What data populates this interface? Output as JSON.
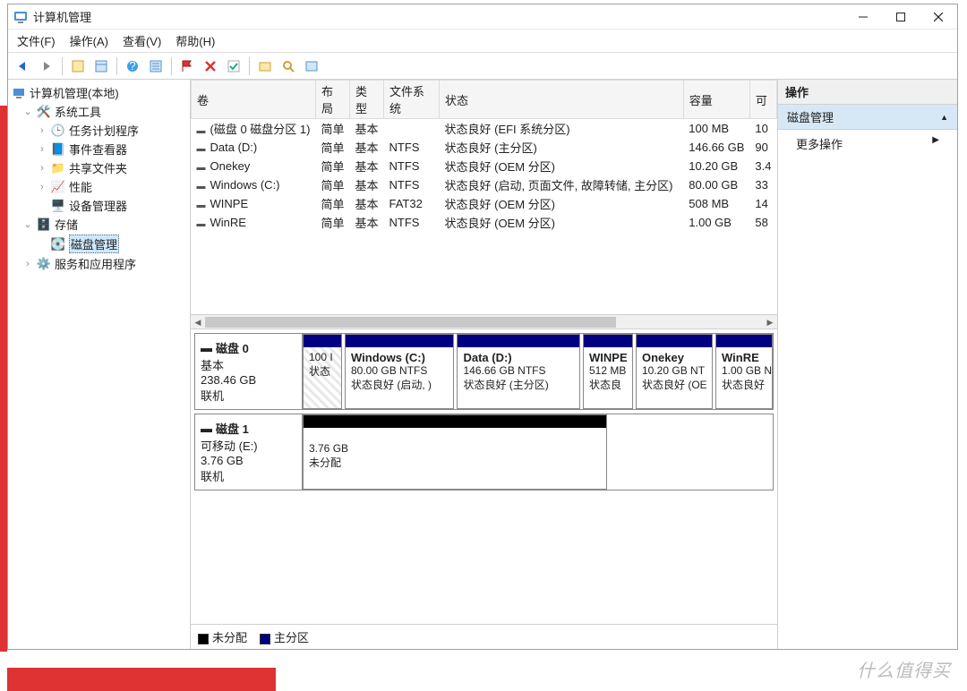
{
  "window": {
    "title": "计算机管理"
  },
  "menu": {
    "file": "文件(F)",
    "action": "操作(A)",
    "view": "查看(V)",
    "help": "帮助(H)"
  },
  "tree": {
    "root": "计算机管理(本地)",
    "systools": "系统工具",
    "task": "任务计划程序",
    "event": "事件查看器",
    "shared": "共享文件夹",
    "perf": "性能",
    "devmgr": "设备管理器",
    "storage": "存储",
    "diskmgmt": "磁盘管理",
    "services": "服务和应用程序"
  },
  "cols": {
    "vol": "卷",
    "layout": "布局",
    "type": "类型",
    "fs": "文件系统",
    "status": "状态",
    "cap": "容量",
    "free": "可"
  },
  "volumes": [
    {
      "name": "(磁盘 0 磁盘分区 1)",
      "layout": "简单",
      "type": "基本",
      "fs": "",
      "status": "状态良好 (EFI 系统分区)",
      "cap": "100 MB",
      "free": "10"
    },
    {
      "name": "Data (D:)",
      "layout": "简单",
      "type": "基本",
      "fs": "NTFS",
      "status": "状态良好 (主分区)",
      "cap": "146.66 GB",
      "free": "90"
    },
    {
      "name": "Onekey",
      "layout": "简单",
      "type": "基本",
      "fs": "NTFS",
      "status": "状态良好 (OEM 分区)",
      "cap": "10.20 GB",
      "free": "3.4"
    },
    {
      "name": "Windows (C:)",
      "layout": "简单",
      "type": "基本",
      "fs": "NTFS",
      "status": "状态良好 (启动, 页面文件, 故障转储, 主分区)",
      "cap": "80.00 GB",
      "free": "33"
    },
    {
      "name": "WINPE",
      "layout": "简单",
      "type": "基本",
      "fs": "FAT32",
      "status": "状态良好 (OEM 分区)",
      "cap": "508 MB",
      "free": "14"
    },
    {
      "name": "WinRE",
      "layout": "简单",
      "type": "基本",
      "fs": "NTFS",
      "status": "状态良好 (OEM 分区)",
      "cap": "1.00 GB",
      "free": "58"
    }
  ],
  "disk0": {
    "title": "磁盘 0",
    "type": "基本",
    "size": "238.46 GB",
    "state": "联机",
    "p0": {
      "l1": "100 I",
      "l2": "状态"
    },
    "p1": {
      "t": "Windows  (C:)",
      "s": "80.00 GB NTFS",
      "st": "状态良好 (启动, )"
    },
    "p2": {
      "t": "Data  (D:)",
      "s": "146.66 GB NTFS",
      "st": "状态良好 (主分区)"
    },
    "p3": {
      "t": "WINPE",
      "s": "512 MB",
      "st": "状态良"
    },
    "p4": {
      "t": "Onekey",
      "s": "10.20 GB NT",
      "st": "状态良好 (OE"
    },
    "p5": {
      "t": "WinRE",
      "s": "1.00 GB N",
      "st": "状态良好"
    }
  },
  "disk1": {
    "title": "磁盘 1",
    "type": "可移动 (E:)",
    "size": "3.76 GB",
    "state": "联机",
    "p0": {
      "s": "3.76 GB",
      "st": "未分配"
    }
  },
  "legend": {
    "un": "未分配",
    "pri": "主分区"
  },
  "actions": {
    "hdr": "操作",
    "sec": "磁盘管理",
    "more": "更多操作"
  },
  "watermark": "什么值得买"
}
